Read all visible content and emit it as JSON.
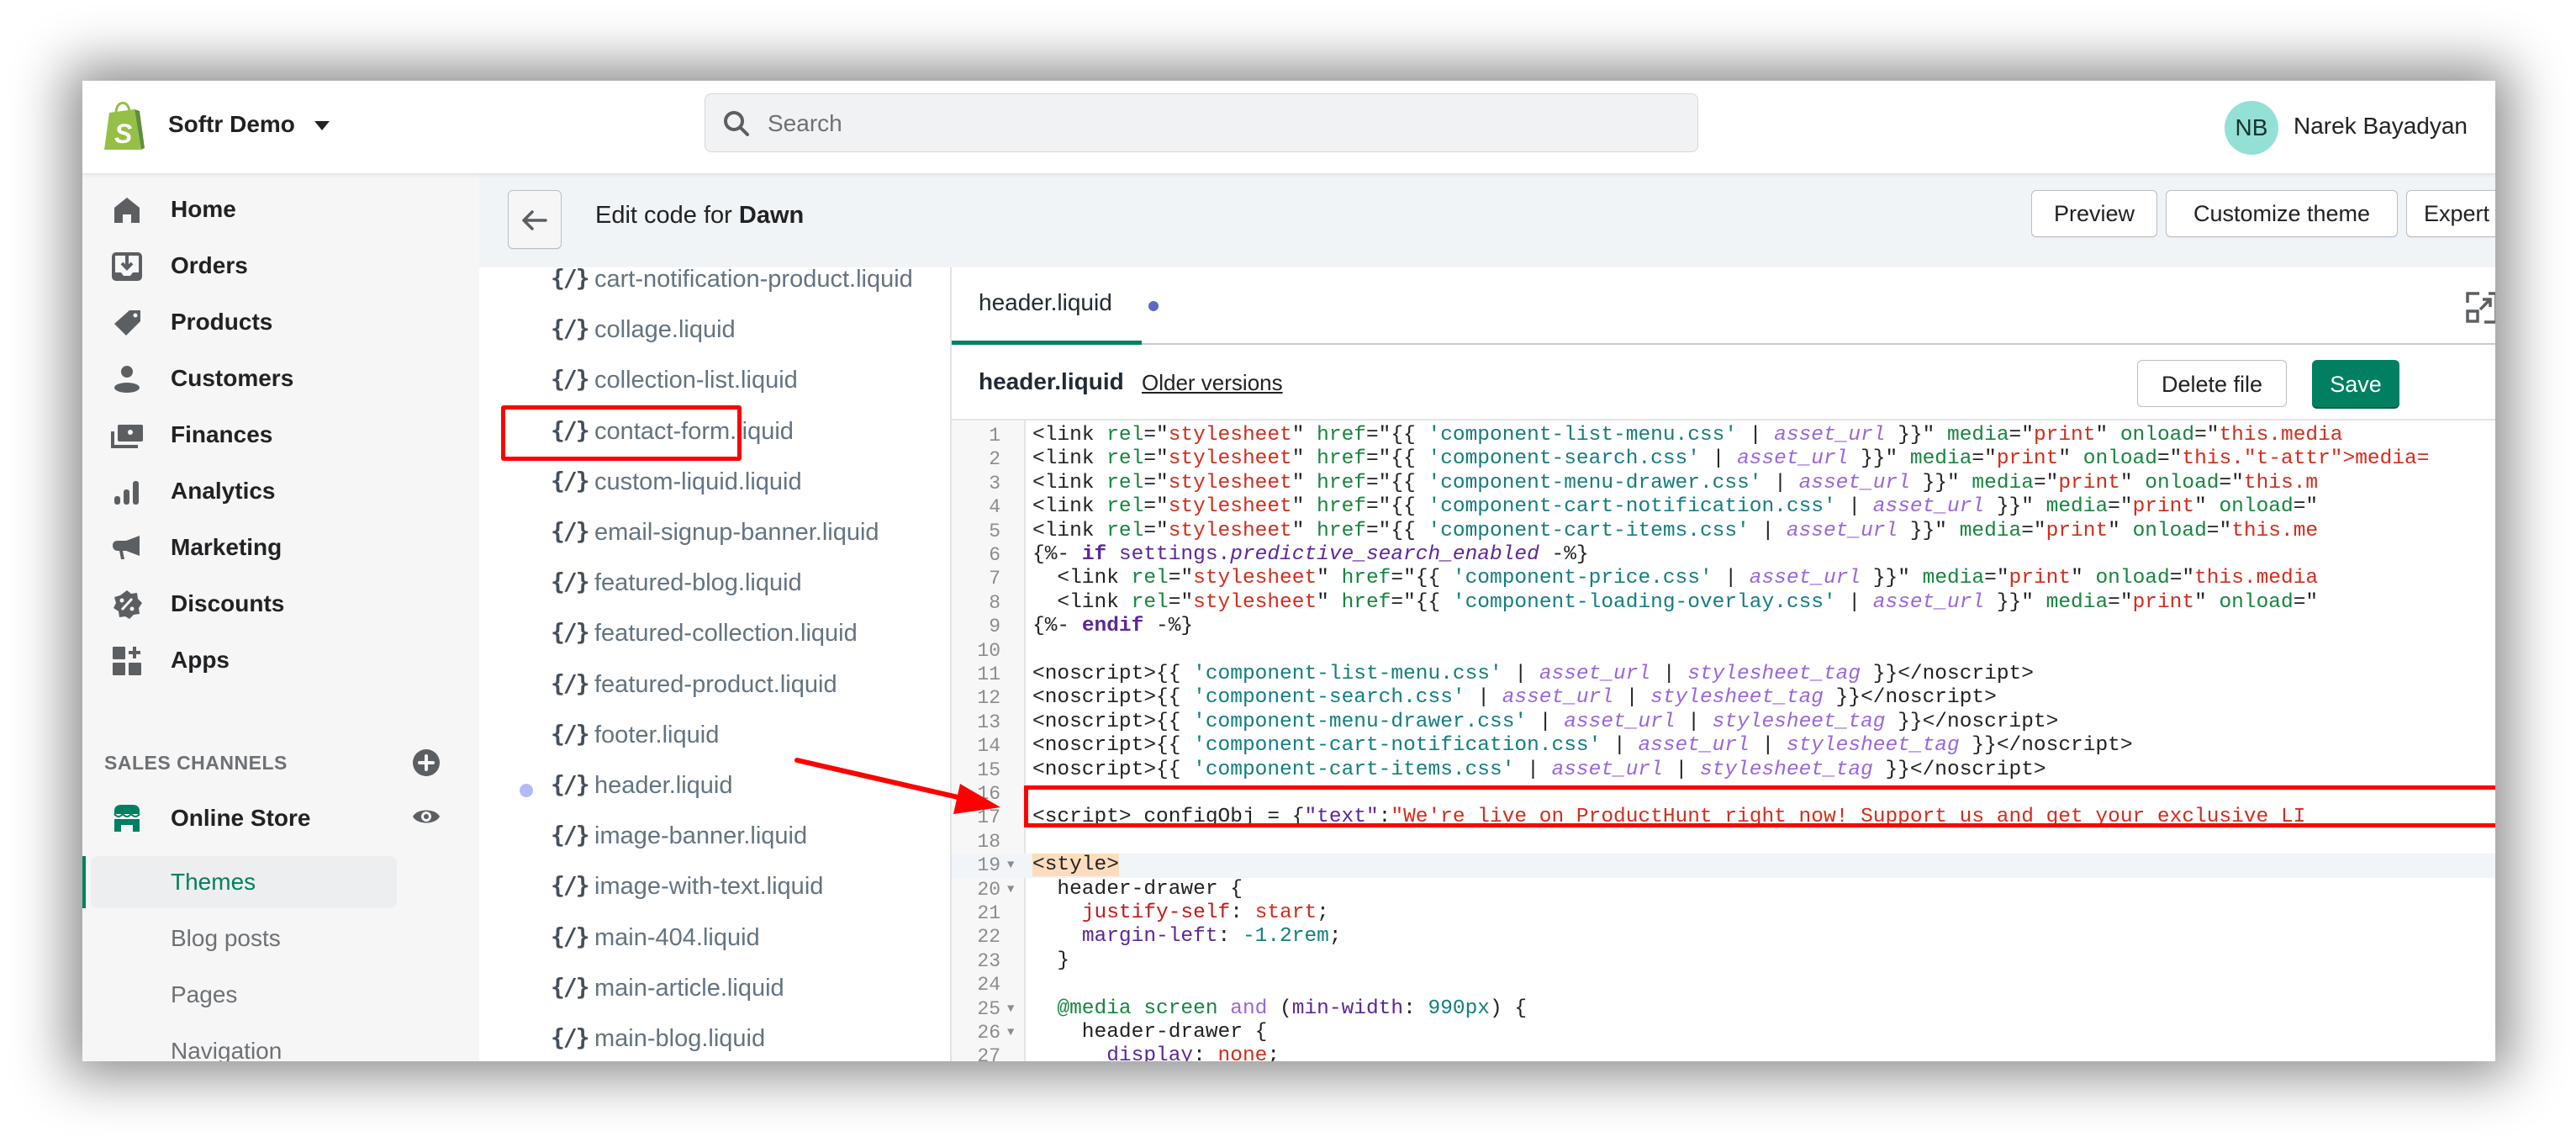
{
  "topbar": {
    "store_name": "Softr Demo",
    "search_placeholder": "Search",
    "user_initials": "NB",
    "user_name": "Narek Bayadyan",
    "avatar_color": "#93e0d4"
  },
  "sidebar": {
    "items": [
      {
        "label": "Home",
        "icon": "home-icon"
      },
      {
        "label": "Orders",
        "icon": "orders-icon"
      },
      {
        "label": "Products",
        "icon": "tag-icon"
      },
      {
        "label": "Customers",
        "icon": "person-icon"
      },
      {
        "label": "Finances",
        "icon": "finances-icon"
      },
      {
        "label": "Analytics",
        "icon": "bar-chart-icon"
      },
      {
        "label": "Marketing",
        "icon": "megaphone-icon"
      },
      {
        "label": "Discounts",
        "icon": "discount-icon"
      },
      {
        "label": "Apps",
        "icon": "apps-icon"
      }
    ],
    "section_title": "SALES CHANNELS",
    "channel": {
      "label": "Online Store",
      "icon": "store-icon"
    },
    "sub_items": [
      {
        "label": "Themes",
        "active": true
      },
      {
        "label": "Blog posts",
        "active": false
      },
      {
        "label": "Pages",
        "active": false
      },
      {
        "label": "Navigation",
        "active": false
      }
    ]
  },
  "page_header": {
    "title_prefix": "Edit code for ",
    "theme_name": "Dawn",
    "buttons": {
      "preview": "Preview",
      "customize": "Customize theme",
      "expert_help": "Expert theme help"
    }
  },
  "file_list": {
    "icon_glyph": "{/}",
    "files": [
      {
        "name": "cart-notification-product.liquid",
        "modified": false
      },
      {
        "name": "collage.liquid",
        "modified": false
      },
      {
        "name": "collection-list.liquid",
        "modified": false
      },
      {
        "name": "contact-form.liquid",
        "modified": false
      },
      {
        "name": "custom-liquid.liquid",
        "modified": false
      },
      {
        "name": "email-signup-banner.liquid",
        "modified": false
      },
      {
        "name": "featured-blog.liquid",
        "modified": false
      },
      {
        "name": "featured-collection.liquid",
        "modified": false
      },
      {
        "name": "featured-product.liquid",
        "modified": false
      },
      {
        "name": "footer.liquid",
        "modified": false
      },
      {
        "name": "header.liquid",
        "modified": true,
        "selected": true
      },
      {
        "name": "image-banner.liquid",
        "modified": false
      },
      {
        "name": "image-with-text.liquid",
        "modified": false
      },
      {
        "name": "main-404.liquid",
        "modified": false
      },
      {
        "name": "main-article.liquid",
        "modified": false
      },
      {
        "name": "main-blog.liquid",
        "modified": false
      }
    ]
  },
  "editor": {
    "tab_label": "header.liquid",
    "file_title": "header.liquid",
    "older_versions": "Older versions",
    "delete_label": "Delete file",
    "save_label": "Save",
    "accent_color": "#008060",
    "lines": [
      {
        "n": "1",
        "code": "<link rel=\"stylesheet\" href=\"{{ 'component-list-menu.css' | asset_url }}\" media=\"print\" onload=\"this.media"
      },
      {
        "n": "2",
        "code": "<link rel=\"stylesheet\" href=\"{{ 'component-search.css' | asset_url }}\" media=\"print\" onload=\"this.media="
      },
      {
        "n": "3",
        "code": "<link rel=\"stylesheet\" href=\"{{ 'component-menu-drawer.css' | asset_url }}\" media=\"print\" onload=\"this.m"
      },
      {
        "n": "4",
        "code": "<link rel=\"stylesheet\" href=\"{{ 'component-cart-notification.css' | asset_url }}\" media=\"print\" onload=\""
      },
      {
        "n": "5",
        "code": "<link rel=\"stylesheet\" href=\"{{ 'component-cart-items.css' | asset_url }}\" media=\"print\" onload=\"this.me"
      },
      {
        "n": "6",
        "code": "{%- if settings.predictive_search_enabled -%}"
      },
      {
        "n": "7",
        "code": "  <link rel=\"stylesheet\" href=\"{{ 'component-price.css' | asset_url }}\" media=\"print\" onload=\"this.media"
      },
      {
        "n": "8",
        "code": "  <link rel=\"stylesheet\" href=\"{{ 'component-loading-overlay.css' | asset_url }}\" media=\"print\" onload=\""
      },
      {
        "n": "9",
        "code": "{%- endif -%}"
      },
      {
        "n": "10",
        "code": ""
      },
      {
        "n": "11",
        "code": "<noscript>{{ 'component-list-menu.css' | asset_url | stylesheet_tag }}</noscript>"
      },
      {
        "n": "12",
        "code": "<noscript>{{ 'component-search.css' | asset_url | stylesheet_tag }}</noscript>"
      },
      {
        "n": "13",
        "code": "<noscript>{{ 'component-menu-drawer.css' | asset_url | stylesheet_tag }}</noscript>"
      },
      {
        "n": "14",
        "code": "<noscript>{{ 'component-cart-notification.css' | asset_url | stylesheet_tag }}</noscript>"
      },
      {
        "n": "15",
        "code": "<noscript>{{ 'component-cart-items.css' | asset_url | stylesheet_tag }}</noscript>"
      },
      {
        "n": "16",
        "code": ""
      },
      {
        "n": "17",
        "code": "<script> configObj = {\"text\":\"We're live on ProductHunt right now! Support us and get your exclusive LI"
      },
      {
        "n": "18",
        "code": ""
      },
      {
        "n": "19",
        "code": "<style>",
        "fold": true
      },
      {
        "n": "20",
        "code": "  header-drawer {",
        "fold": true
      },
      {
        "n": "21",
        "code": "    justify-self: start;"
      },
      {
        "n": "22",
        "code": "    margin-left: -1.2rem;"
      },
      {
        "n": "23",
        "code": "  }"
      },
      {
        "n": "24",
        "code": ""
      },
      {
        "n": "25",
        "code": "  @media screen and (min-width: 990px) {",
        "fold": true
      },
      {
        "n": "26",
        "code": "    header-drawer {",
        "fold": true
      },
      {
        "n": "27",
        "code": "      display: none;"
      }
    ]
  },
  "annotation": {
    "highlight_color": "#ff0000"
  }
}
